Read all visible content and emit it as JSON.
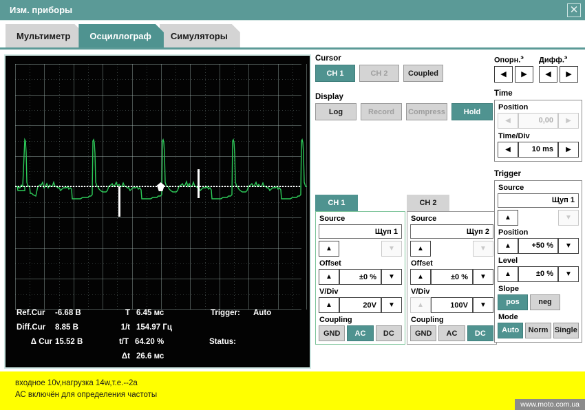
{
  "window": {
    "title": "Изм. приборы",
    "close_icon": "close-icon"
  },
  "tabs": [
    {
      "label": "Мультиметр",
      "active": false
    },
    {
      "label": "Осциллограф",
      "active": true
    },
    {
      "label": "Симуляторы",
      "active": false
    }
  ],
  "scope": {
    "readout": {
      "rows": [
        {
          "label": "Ref.Cur",
          "value": "-6.68 В",
          "label2": "T",
          "value2": "6.45 мс",
          "label3": "Trigger:",
          "value3": "Auto"
        },
        {
          "label": "Diff.Cur",
          "value": "8.85 В",
          "label2": "1/t",
          "value2": "154.97 Гц",
          "label3": "",
          "value3": ""
        },
        {
          "label": "Δ Cur",
          "value": "15.52 В",
          "label2": "t/T",
          "value2": "64.20 %",
          "label3": "Status:",
          "value3": ""
        },
        {
          "label": "",
          "value": "",
          "label2": "Δt",
          "value2": "26.6 мс",
          "label3": "",
          "value3": ""
        }
      ]
    },
    "trace_color": "#2ecc5a",
    "cursor_color": "#ffffff",
    "grid_cols": 10,
    "grid_rows": 8
  },
  "cursor": {
    "label": "Cursor",
    "buttons": [
      {
        "label": "CH 1",
        "active": true,
        "disabled": false
      },
      {
        "label": "CH 2",
        "active": false,
        "disabled": true
      },
      {
        "label": "Coupled",
        "active": false,
        "disabled": false
      }
    ]
  },
  "display": {
    "label": "Display",
    "buttons": [
      {
        "label": "Log",
        "active": false,
        "disabled": false
      },
      {
        "label": "Record",
        "active": false,
        "disabled": true
      },
      {
        "label": "Compress",
        "active": false,
        "disabled": true
      },
      {
        "label": "Hold",
        "active": true,
        "disabled": false
      }
    ]
  },
  "ch1": {
    "tab_label": "CH 1",
    "active": true,
    "source_label": "Source",
    "source_value": "Щуп 1",
    "offset_label": "Offset",
    "offset_value": "±0 %",
    "vdiv_label": "V/Div",
    "vdiv_value": "20V",
    "coupling_label": "Coupling",
    "coupling": [
      {
        "label": "GND",
        "active": false
      },
      {
        "label": "AC",
        "active": true
      },
      {
        "label": "DC",
        "active": false
      }
    ]
  },
  "ch2": {
    "tab_label": "CH 2",
    "active": false,
    "source_label": "Source",
    "source_value": "Щуп 2",
    "offset_label": "Offset",
    "offset_value": "±0 %",
    "vdiv_label": "V/Div",
    "vdiv_value": "100V",
    "coupling_label": "Coupling",
    "coupling": [
      {
        "label": "GND",
        "active": false
      },
      {
        "label": "AC",
        "active": false
      },
      {
        "label": "DC",
        "active": true
      }
    ]
  },
  "refdiff": {
    "ref_label": "Опорн.",
    "ref_sup": "э",
    "diff_label": "Дифф.",
    "diff_sup": "э"
  },
  "time": {
    "label": "Time",
    "position_label": "Position",
    "position_value": "0,00",
    "position_disabled": true,
    "timediv_label": "Time/Div",
    "timediv_value": "10 ms"
  },
  "trigger": {
    "label": "Trigger",
    "source_label": "Source",
    "source_value": "Щуп 1",
    "position_label": "Position",
    "position_value": "+50 %",
    "level_label": "Level",
    "level_value": "±0 %",
    "slope_label": "Slope",
    "slope": [
      {
        "label": "pos",
        "active": true
      },
      {
        "label": "neg",
        "active": false
      }
    ],
    "mode_label": "Mode",
    "mode": [
      {
        "label": "Auto",
        "active": true
      },
      {
        "label": "Norm",
        "active": false
      },
      {
        "label": "Single",
        "active": false
      }
    ]
  },
  "caption": {
    "text": "входное 10v,нагрузка 14w,т.е.--2a\nАС включён для определения частоты"
  },
  "watermark": {
    "text": "www.moto.com.ua"
  }
}
